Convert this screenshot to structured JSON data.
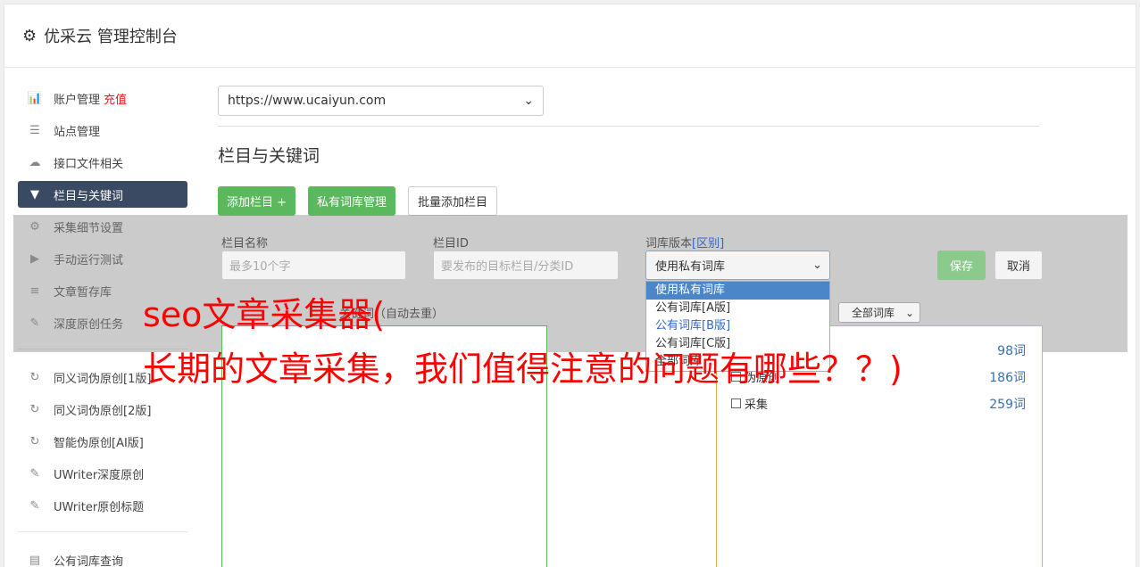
{
  "header": {
    "title": "优采云 管理控制台"
  },
  "sidebar": {
    "items": [
      {
        "icon": "bar-chart-icon",
        "glyph": "📊",
        "label": "账户管理",
        "badge": "充值"
      },
      {
        "icon": "server-icon",
        "glyph": "☰",
        "label": "站点管理"
      },
      {
        "icon": "cloud-upload-icon",
        "glyph": "☁",
        "label": "接口文件相关"
      },
      {
        "icon": "filter-icon",
        "glyph": "▼",
        "label": "栏目与关键词",
        "active": true
      },
      {
        "icon": "cogs-icon",
        "glyph": "⚙",
        "label": "采集细节设置"
      },
      {
        "icon": "play-icon",
        "glyph": "▶",
        "label": "手动运行测试"
      },
      {
        "icon": "database-icon",
        "glyph": "≡",
        "label": "文章暂存库"
      },
      {
        "icon": "edit-icon",
        "glyph": "✎",
        "label": "深度原创任务"
      }
    ],
    "items2": [
      {
        "icon": "refresh-icon",
        "glyph": "↻",
        "label": "同义词伪原创[1版]"
      },
      {
        "icon": "refresh-icon",
        "glyph": "↻",
        "label": "同义词伪原创[2版]"
      },
      {
        "icon": "refresh-icon",
        "glyph": "↻",
        "label": "智能伪原创[AI版]"
      },
      {
        "icon": "edit-icon",
        "glyph": "✎",
        "label": "UWriter深度原创"
      },
      {
        "icon": "edit-icon",
        "glyph": "✎",
        "label": "UWriter原创标题"
      }
    ],
    "items3": [
      {
        "icon": "book-icon",
        "glyph": "▤",
        "label": "公有词库查询"
      }
    ]
  },
  "main": {
    "site_select": "https://www.ucaiyun.com",
    "section_title": "栏目与关键词",
    "buttons": {
      "add_column": "添加栏目 +",
      "private_lib": "私有词库管理",
      "batch_add": "批量添加栏目"
    }
  },
  "form": {
    "name_label": "栏目名称",
    "name_placeholder": "最多10个字",
    "id_label": "栏目ID",
    "id_placeholder": "要发布的目标栏目/分类ID",
    "version_label": "词库版本",
    "version_link": "[区别]",
    "version_selected": "使用私有词库",
    "version_options": [
      "使用私有词库",
      "公有词库[A版]",
      "公有词库[B版]",
      "公有词库[C版]",
      "全部词库"
    ],
    "save": "保存",
    "cancel": "取消",
    "keyword_label": "关键词（自动去重）",
    "lib_filter": "全部词库"
  },
  "libraries": [
    {
      "name": "伪原创",
      "count": "98词"
    },
    {
      "name": "伪原创",
      "count": "186词"
    },
    {
      "name": "采集",
      "count": "259词"
    }
  ],
  "watermark": {
    "line1": "seo文章采集器(",
    "line2": "长期的文章采集，我们值得注意的问题有哪些？？)"
  },
  "colors": {
    "active_nav": "#3b4a63",
    "green": "#5cb85c",
    "orange": "#f0ad4e",
    "watermark": "#ff0000"
  }
}
